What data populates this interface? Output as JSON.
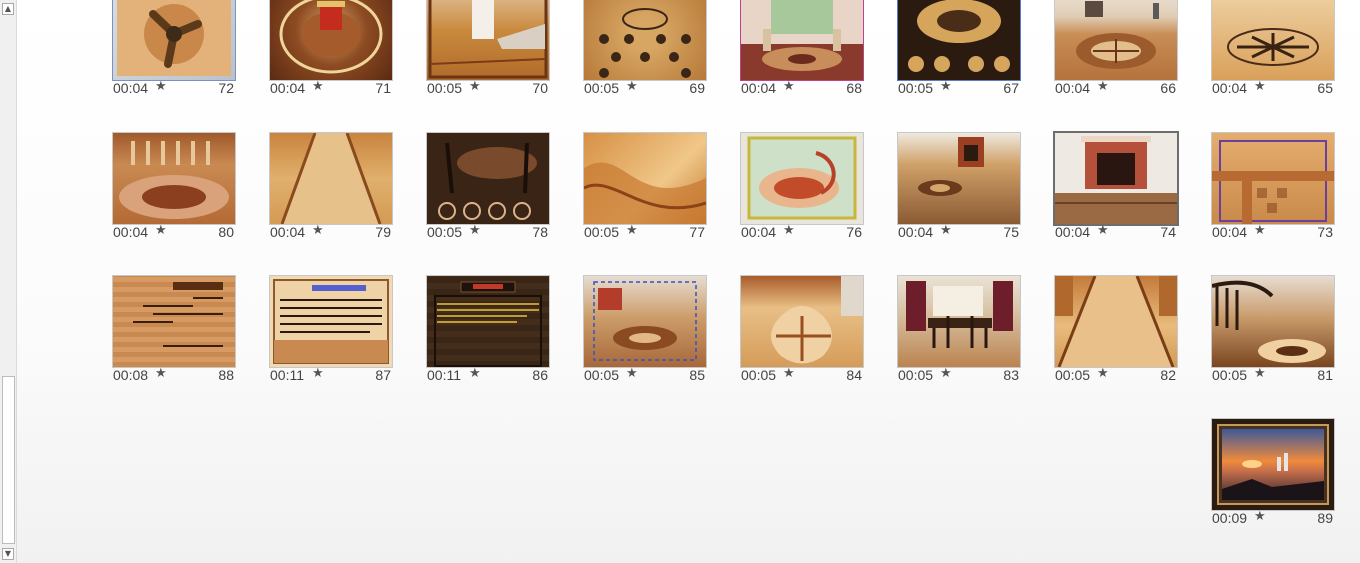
{
  "scrollbar": {
    "up_icon": "▲",
    "down_icon": "▼"
  },
  "star_glyph": "★",
  "slides": [
    {
      "num": "72",
      "duration": "00:04"
    },
    {
      "num": "71",
      "duration": "00:04"
    },
    {
      "num": "70",
      "duration": "00:05"
    },
    {
      "num": "69",
      "duration": "00:05"
    },
    {
      "num": "68",
      "duration": "00:04"
    },
    {
      "num": "67",
      "duration": "00:05"
    },
    {
      "num": "66",
      "duration": "00:04"
    },
    {
      "num": "65",
      "duration": "00:04"
    },
    {
      "num": "80",
      "duration": "00:04"
    },
    {
      "num": "79",
      "duration": "00:04"
    },
    {
      "num": "78",
      "duration": "00:05"
    },
    {
      "num": "77",
      "duration": "00:05"
    },
    {
      "num": "76",
      "duration": "00:04"
    },
    {
      "num": "75",
      "duration": "00:04"
    },
    {
      "num": "74",
      "duration": "00:04"
    },
    {
      "num": "73",
      "duration": "00:04"
    },
    {
      "num": "88",
      "duration": "00:08"
    },
    {
      "num": "87",
      "duration": "00:11"
    },
    {
      "num": "86",
      "duration": "00:11"
    },
    {
      "num": "85",
      "duration": "00:05"
    },
    {
      "num": "84",
      "duration": "00:05"
    },
    {
      "num": "83",
      "duration": "00:05"
    },
    {
      "num": "82",
      "duration": "00:05"
    },
    {
      "num": "81",
      "duration": "00:05"
    },
    {
      "num": "89",
      "duration": "00:09"
    }
  ],
  "colors": {
    "selected_border": "#6d6d6d",
    "thumb_border": "#c8c8c8"
  }
}
